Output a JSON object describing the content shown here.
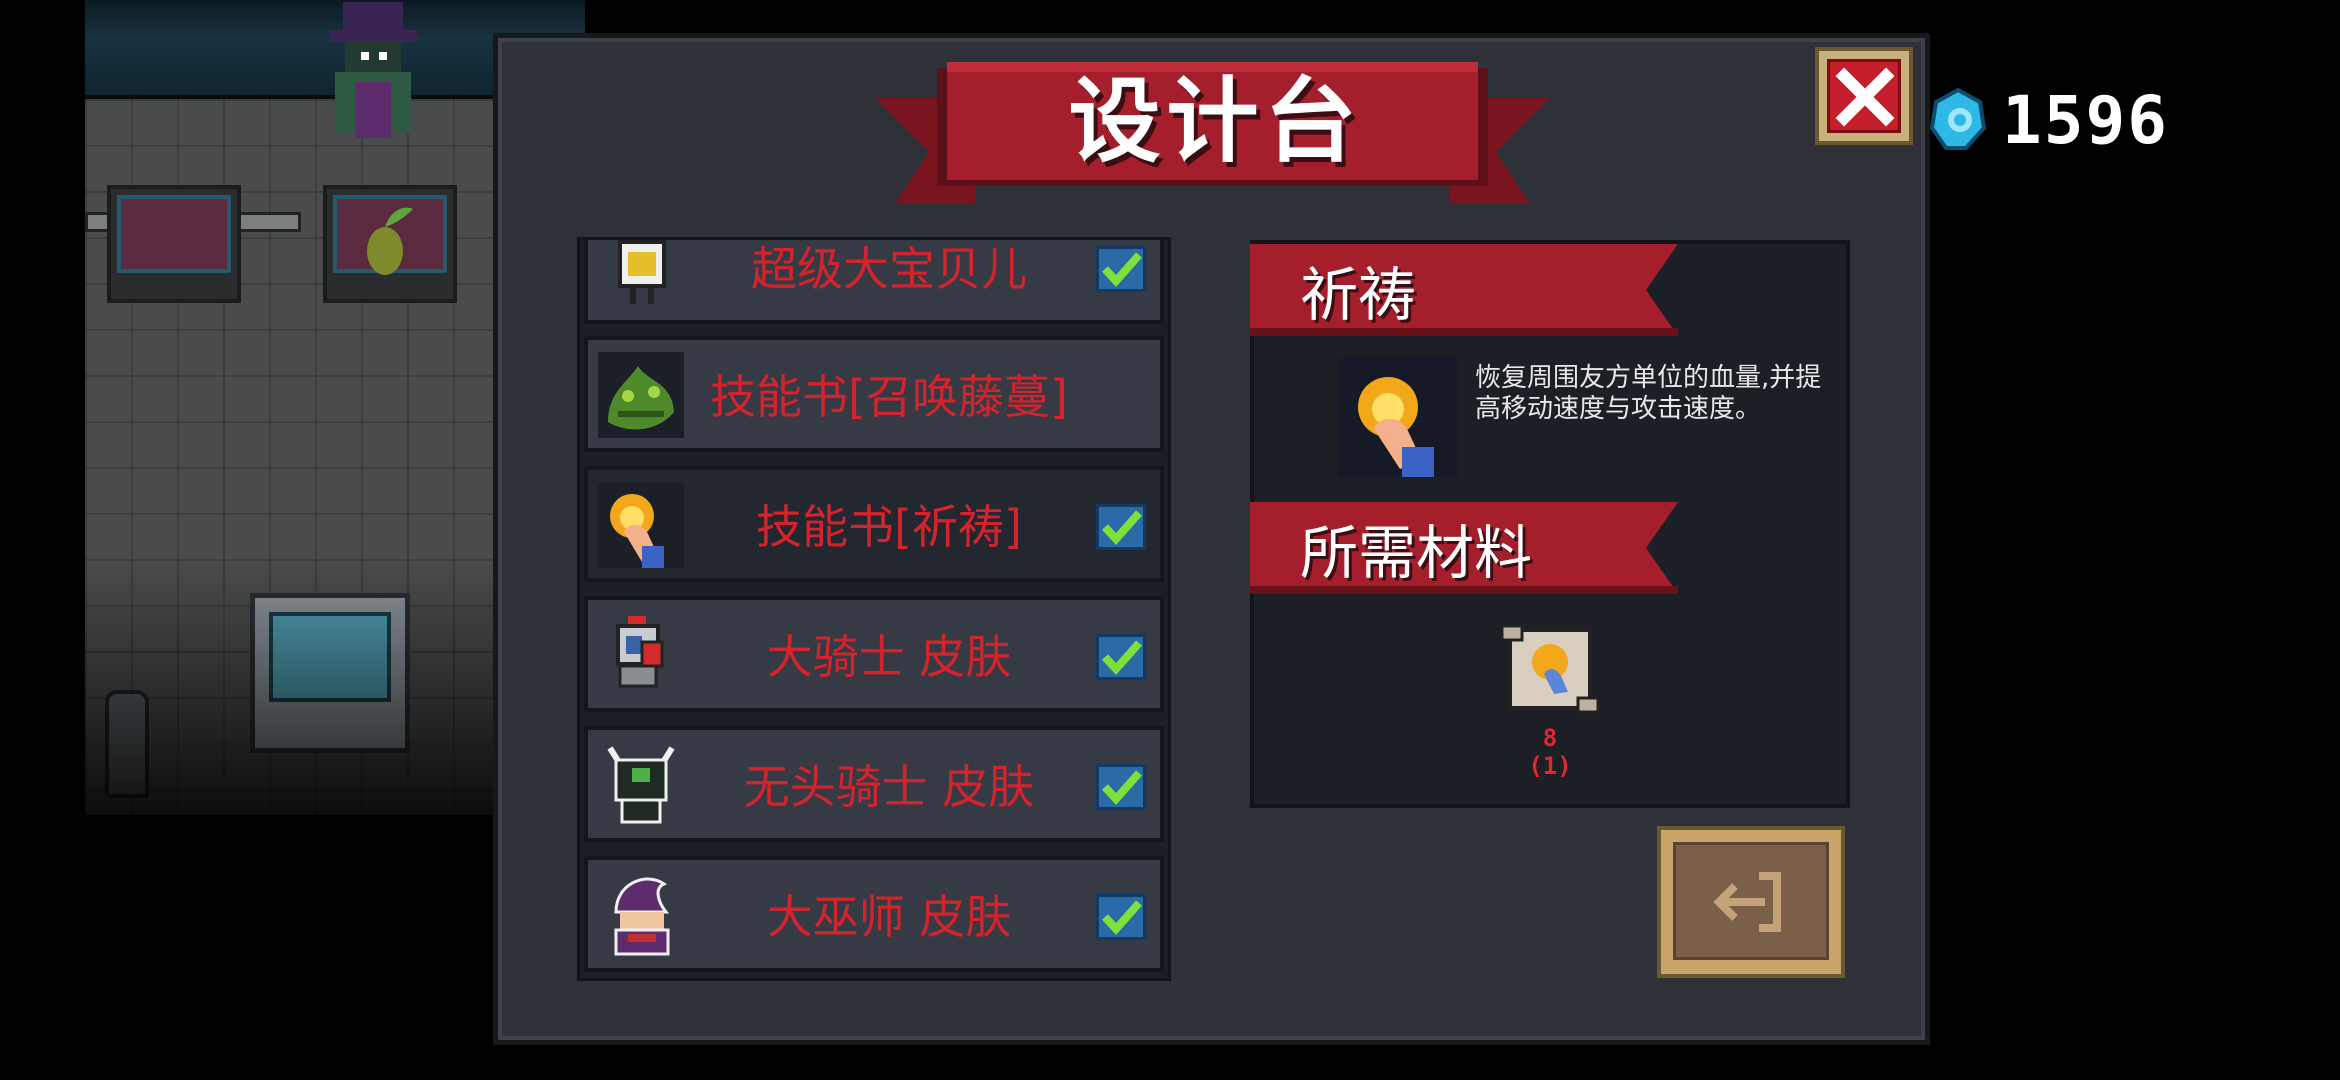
{
  "title": "设计台",
  "currency": {
    "icon": "blue-gem-icon",
    "amount": "1596"
  },
  "close_button": {
    "icon": "close-x-icon"
  },
  "recipes": [
    {
      "name": "超级大宝贝儿",
      "icon": "baby-robot-icon",
      "unlocked": true,
      "selected": false
    },
    {
      "name": "技能书[召唤藤蔓]",
      "icon": "vine-monster-icon",
      "unlocked": false,
      "selected": false
    },
    {
      "name": "技能书[祈祷]",
      "icon": "praying-hand-fire-icon",
      "unlocked": true,
      "selected": true
    },
    {
      "name": "大骑士 皮肤",
      "icon": "knight-skin-icon",
      "unlocked": true,
      "selected": false
    },
    {
      "name": "无头骑士 皮肤",
      "icon": "headless-knight-skin-icon",
      "unlocked": true,
      "selected": false
    },
    {
      "name": "大巫师 皮肤",
      "icon": "wizard-skin-icon",
      "unlocked": true,
      "selected": false
    }
  ],
  "detail": {
    "name": "祈祷",
    "icon": "praying-hand-fire-icon",
    "description": "恢复周围友方单位的血量,并提高移动速度与攻击速度。"
  },
  "materials": {
    "heading": "所需材料",
    "items": [
      {
        "icon": "prayer-scroll-icon",
        "owned": "8",
        "required": "(1)"
      }
    ]
  },
  "exit_button": {
    "icon": "exit-door-icon"
  },
  "colors": {
    "panel": "#2e3238",
    "ribbon": "#a51e2b",
    "label_red": "#d3232c",
    "check_green": "#7ee03a"
  }
}
